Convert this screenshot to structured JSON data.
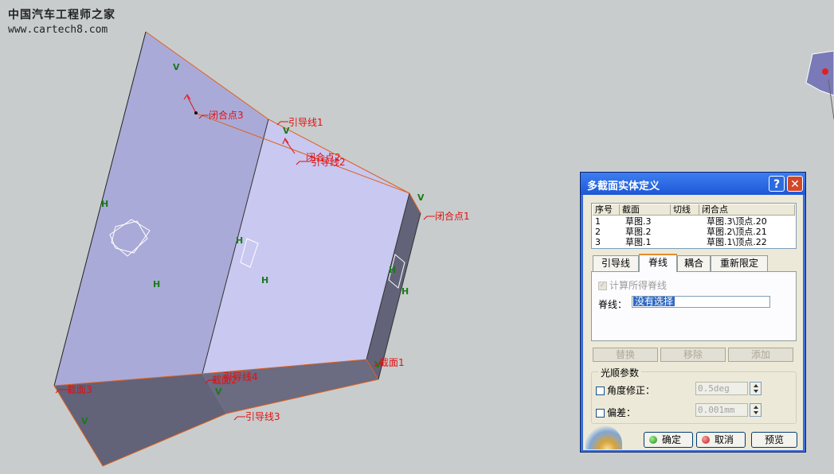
{
  "watermark": {
    "line1": "中国汽车工程师之家",
    "line2": "www.cartech8.com"
  },
  "viewport_labels": {
    "close_pt3": "闭合点3",
    "guide1": "引导线1",
    "close_pt2": "闭合点2",
    "guide2": "引导线2",
    "close_pt1": "闭合点1",
    "section1": "截面1",
    "section3": "截面3",
    "section2": "截面2",
    "guide4": "引导线4",
    "guide3": "引导线3",
    "mark_v": "V",
    "mark_h": "H"
  },
  "dialog": {
    "title": "多截面实体定义",
    "help": "?",
    "close": "✕",
    "table": {
      "headers": [
        "序号",
        "截面",
        "切线",
        "闭合点"
      ],
      "rows": [
        [
          "1",
          "草图.3",
          "",
          "草图.3\\顶点.20"
        ],
        [
          "2",
          "草图.2",
          "",
          "草图.2\\顶点.21"
        ],
        [
          "3",
          "草图.1",
          "",
          "草图.1\\顶点.22"
        ]
      ]
    },
    "tabs": [
      "引导线",
      "脊线",
      "耦合",
      "重新限定"
    ],
    "active_tab": "脊线",
    "compute_spine": "计算所得脊线",
    "spine_label": "脊线：",
    "spine_value": "没有选择",
    "actions": [
      "替换",
      "移除",
      "添加"
    ],
    "smooth": {
      "title": "光顺参数",
      "angle_label": "角度修正：",
      "angle_value": "0.5deg",
      "deviation_label": "偏差：",
      "deviation_value": "0.001mm"
    },
    "buttons": {
      "ok": "确定",
      "cancel": "取消",
      "preview": "预览"
    }
  },
  "colors": {
    "label_red": "#e01010",
    "edge_orange": "#e0601a",
    "face_light": "#c8c8f0",
    "face_mid": "#aaaad8",
    "face_dark": "#626279"
  }
}
